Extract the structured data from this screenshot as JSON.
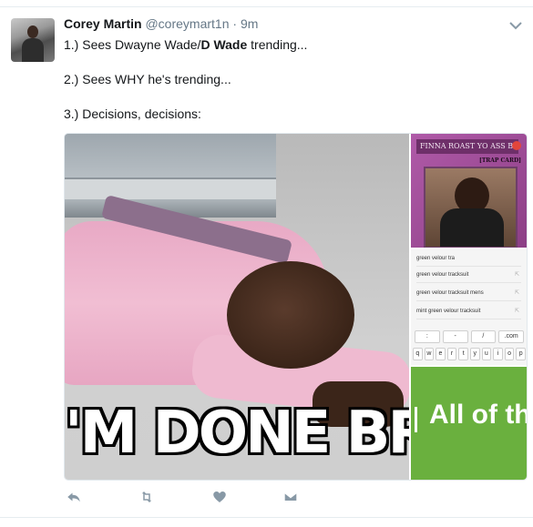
{
  "tweet": {
    "author_name": "Corey Martin",
    "handle": "@coreymart1n",
    "separator": "·",
    "time": "9m",
    "line1_prefix": "1.) Sees Dwayne Wade/",
    "line1_bold": "D Wade",
    "line1_suffix": " trending...",
    "line2": "2.) Sees WHY he's trending...",
    "line3": "3.) Decisions, decisions:"
  },
  "media": {
    "main_caption": "'M DONE BRU",
    "card_title": "FINNA ROAST YO ASS BOI",
    "card_subtitle": "[TRAP CARD]",
    "search_rows": [
      {
        "text": "green velour tra",
        "arrow": ""
      },
      {
        "text": "green velour tracksuit",
        "arrow": "⇱"
      },
      {
        "text": "green velour tracksuit mens",
        "arrow": "⇱"
      },
      {
        "text": "mint green velour tracksuit",
        "arrow": "⇱"
      }
    ],
    "keys_row1": [
      ":",
      "-",
      "/",
      ".com"
    ],
    "keys_row2": [
      "q",
      "w",
      "e",
      "r",
      "t",
      "y",
      "u",
      "i",
      "o",
      "p"
    ],
    "green_text": "All of th"
  },
  "icons": {
    "reply": "reply-icon",
    "retweet": "retweet-icon",
    "like": "heart-icon",
    "dm": "envelope-icon",
    "menu": "chevron-down-icon"
  },
  "colors": {
    "text": "#14171a",
    "muted": "#657786",
    "action": "#8899a6"
  }
}
